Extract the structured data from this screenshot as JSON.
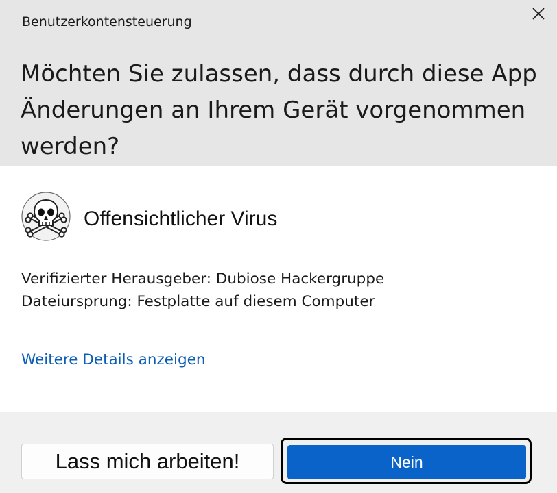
{
  "dialog": {
    "title": "Benutzerkontensteuerung",
    "close_icon": "close-icon",
    "question": "Möchten Sie zulassen, dass durch diese App Änderungen an Ihrem Gerät vorgenommen werden?"
  },
  "app": {
    "icon": "skull-crossbones-icon",
    "name": "Offensichtlicher Virus",
    "publisher": "Verifizierter Herausgeber: Dubiose Hackergruppe",
    "origin": "Dateiursprung: Festplatte auf diesem Computer"
  },
  "details_link": "Weitere Details anzeigen",
  "buttons": {
    "allow": "Lass mich arbeiten!",
    "deny": "Nein"
  },
  "colors": {
    "header_bg": "#e6e6e6",
    "footer_bg": "#f0f0f0",
    "link": "#0c5db5",
    "primary_button": "#0a63c9"
  }
}
